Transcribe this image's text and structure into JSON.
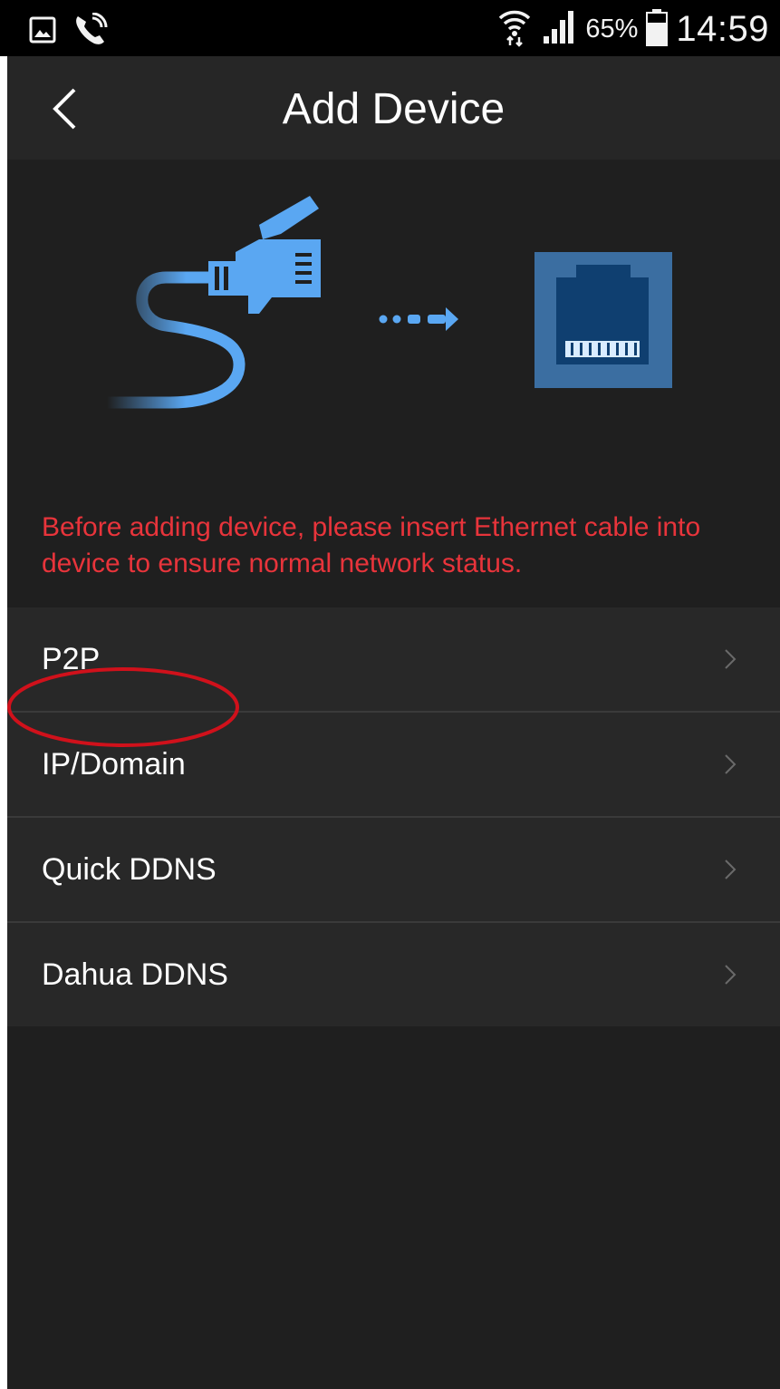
{
  "status_bar": {
    "icons": [
      "gallery-icon",
      "phone-call-icon",
      "wifi-icon",
      "signal-icon",
      "battery-icon"
    ],
    "battery": "65%",
    "time": "14:59"
  },
  "header": {
    "back_icon": "chevron-left-icon",
    "title": "Add Device"
  },
  "illustration": {
    "icons": [
      "ethernet-cable-icon",
      "arrow-right-icon",
      "ethernet-port-icon"
    ]
  },
  "notice": "Before adding device, please insert Ethernet cable into device to ensure normal network status.",
  "menu": {
    "items": [
      {
        "label": "P2P"
      },
      {
        "label": "IP/Domain"
      },
      {
        "label": "Quick DDNS"
      },
      {
        "label": "Dahua DDNS"
      }
    ],
    "chevron_icon": "chevron-right-icon"
  },
  "colors": {
    "background": "#1f1f1f",
    "navbar": "#262626",
    "menu_row": "#282828",
    "notice_text": "#e8343b",
    "accent_blue": "#5aa7f2",
    "annotation": "#d0111b"
  }
}
